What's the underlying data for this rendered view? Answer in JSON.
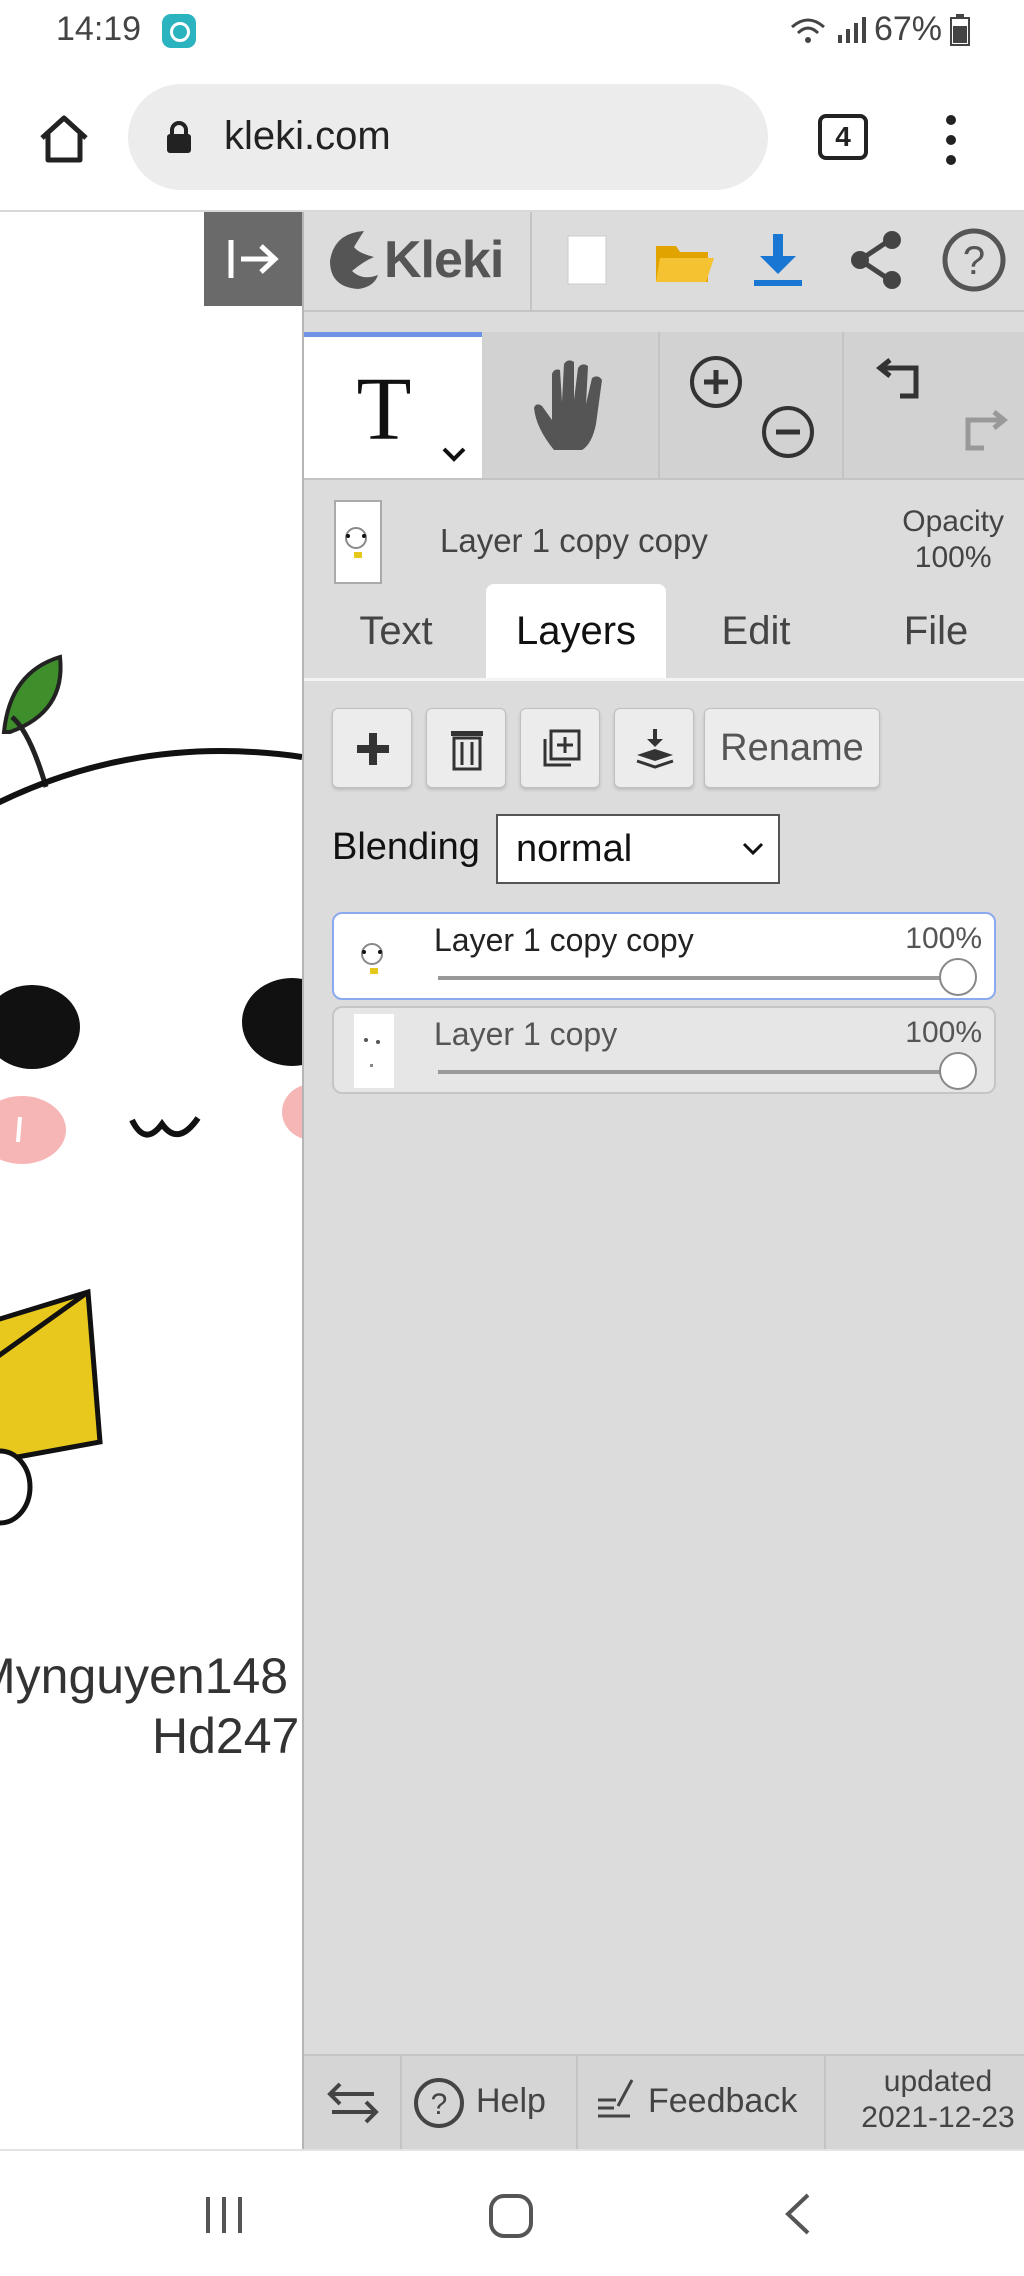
{
  "status": {
    "time": "14:19",
    "battery": "67%"
  },
  "browser": {
    "url": "kleki.com",
    "tab_count": "4"
  },
  "canvas": {
    "text_line1": "Mynguyen148",
    "text_line2": "Hd247"
  },
  "app": {
    "logo_text": "Kleki"
  },
  "layer_info": {
    "current_layer": "Layer 1 copy copy",
    "opacity_label": "Opacity",
    "opacity_value": "100%"
  },
  "tabs": [
    {
      "label": "Text",
      "active": false
    },
    {
      "label": "Layers",
      "active": true
    },
    {
      "label": "Edit",
      "active": false
    },
    {
      "label": "File",
      "active": false
    }
  ],
  "layers_panel": {
    "rename_label": "Rename",
    "blending_label": "Blending",
    "blending_value": "normal",
    "layers": [
      {
        "name": "Layer 1 copy copy",
        "opacity": "100%",
        "opacity_fraction": 1.0,
        "active": true
      },
      {
        "name": "Layer 1 copy",
        "opacity": "100%",
        "opacity_fraction": 1.0,
        "active": false
      }
    ]
  },
  "footer": {
    "help_label": "Help",
    "feedback_label": "Feedback",
    "updated_label": "updated",
    "updated_date": "2021-12-23"
  },
  "colors": {
    "accent": "#6f93e6",
    "download_blue": "#1976d2",
    "folder_yellow": "#f5b400",
    "panel_bg": "#dcdcdc"
  },
  "icons": [
    "home-icon",
    "lock-icon",
    "tabs-icon",
    "menu-dots-icon",
    "collapse-panel-icon",
    "kleki-logo-icon",
    "new-file-icon",
    "open-folder-icon",
    "download-icon",
    "share-icon",
    "help-icon",
    "text-tool-icon",
    "hand-tool-icon",
    "zoom-in-icon",
    "zoom-out-icon",
    "undo-icon",
    "redo-icon",
    "add-layer-icon",
    "delete-layer-icon",
    "duplicate-layer-icon",
    "merge-down-icon",
    "swap-icon",
    "feedback-icon",
    "recents-icon",
    "home-nav-icon",
    "back-icon"
  ]
}
